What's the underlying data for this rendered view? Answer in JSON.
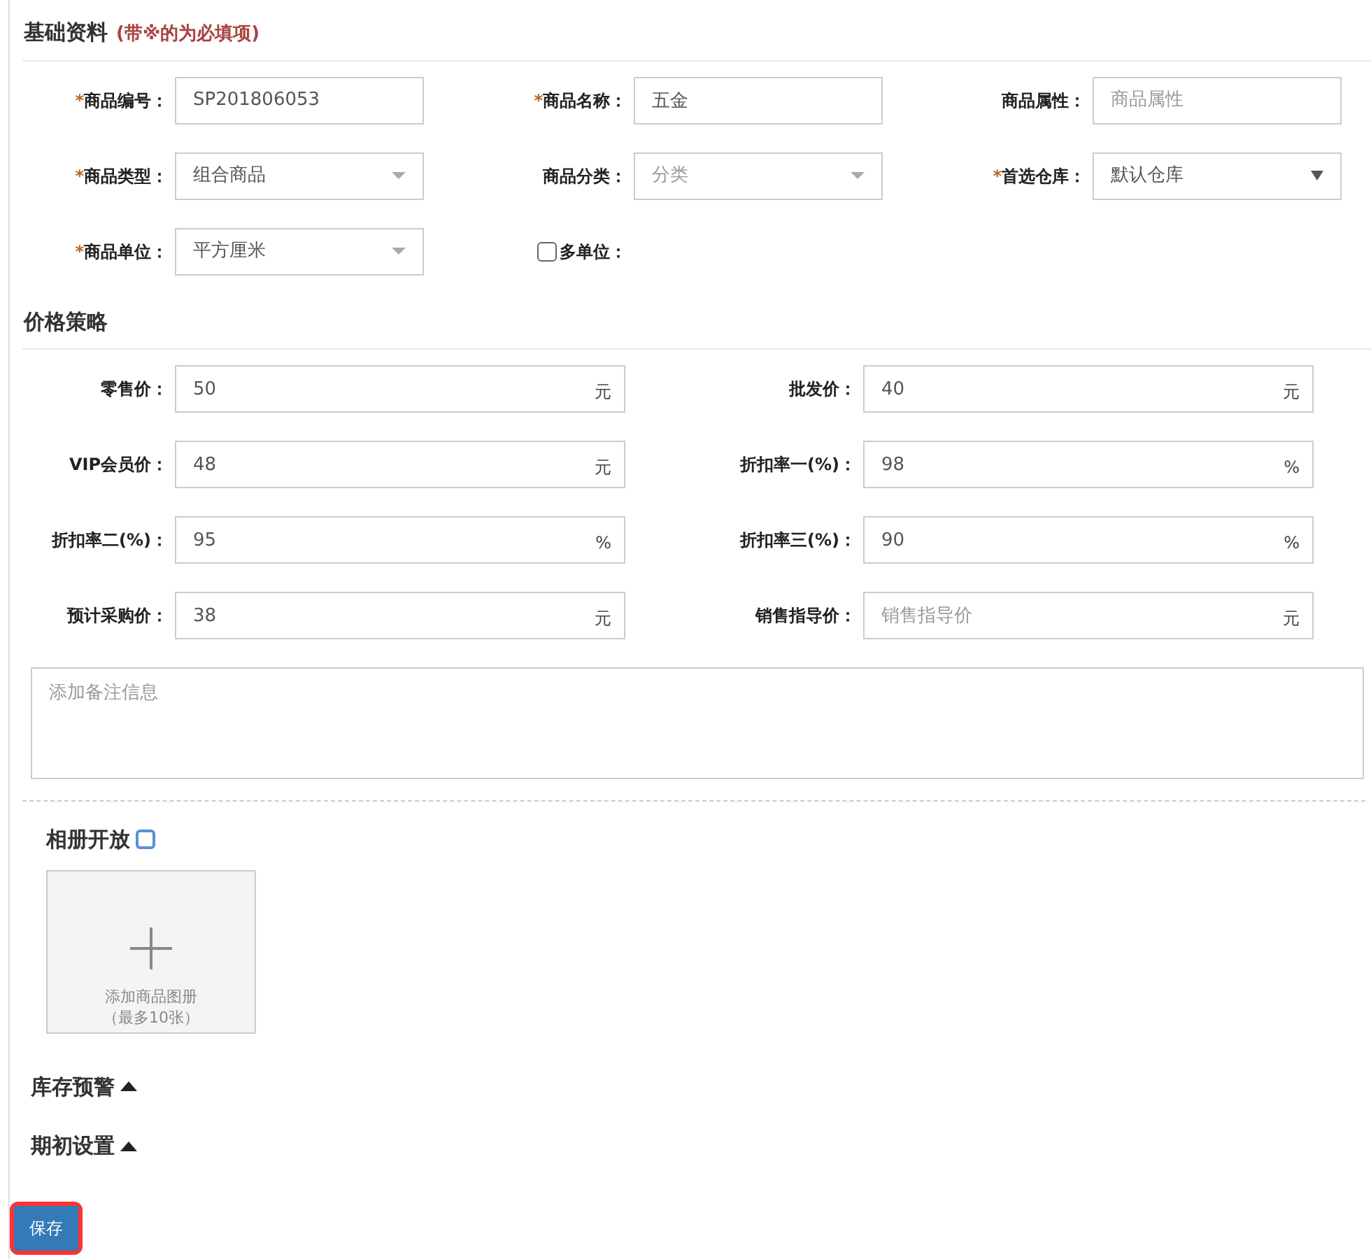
{
  "required_mark": "*",
  "basic_info": {
    "title": "基础资料",
    "note": "(带※的为必填项)",
    "fields": [
      {
        "kind": "text",
        "label": "商品编号：",
        "required": true,
        "value": "SP201806053"
      },
      {
        "kind": "text",
        "label": "商品名称：",
        "required": true,
        "value": "五金"
      },
      {
        "kind": "text",
        "label": "商品属性：",
        "required": false,
        "placeholder": "商品属性"
      },
      {
        "kind": "select",
        "label": "商品类型：",
        "required": true,
        "value": "组合商品"
      },
      {
        "kind": "select",
        "label": "商品分类：",
        "required": false,
        "placeholder": "分类"
      },
      {
        "kind": "native_select",
        "label": "首选仓库：",
        "required": true,
        "value": "默认仓库"
      },
      {
        "kind": "select",
        "label": "商品单位：",
        "required": true,
        "value": "平方厘米"
      },
      {
        "kind": "checkbox",
        "label": "多单位：",
        "checked": false
      }
    ]
  },
  "pricing": {
    "title": "价格策略",
    "fields": [
      {
        "label": "零售价：",
        "value": "50",
        "unit": "元"
      },
      {
        "label": "批发价：",
        "value": "40",
        "unit": "元"
      },
      {
        "label": "VIP会员价：",
        "value": "48",
        "unit": "元"
      },
      {
        "label": "折扣率一(%)：",
        "value": "98",
        "unit": "%"
      },
      {
        "label": "折扣率二(%)：",
        "value": "95",
        "unit": "%"
      },
      {
        "label": "折扣率三(%)：",
        "value": "90",
        "unit": "%"
      },
      {
        "label": "预计采购价：",
        "value": "38",
        "unit": "元"
      },
      {
        "label": "销售指导价：",
        "placeholder": "销售指导价",
        "unit": "元"
      }
    ]
  },
  "remarks": {
    "placeholder": "添加备注信息"
  },
  "album": {
    "title": "相册开放",
    "checked": false,
    "upload_lines": [
      "添加商品图册",
      "（最多10张）"
    ]
  },
  "collapsibles": [
    {
      "title": "库存预警",
      "expanded": false
    },
    {
      "title": "期初设置",
      "expanded": false
    }
  ],
  "save_button": {
    "label": "保存",
    "highlighted": true
  }
}
